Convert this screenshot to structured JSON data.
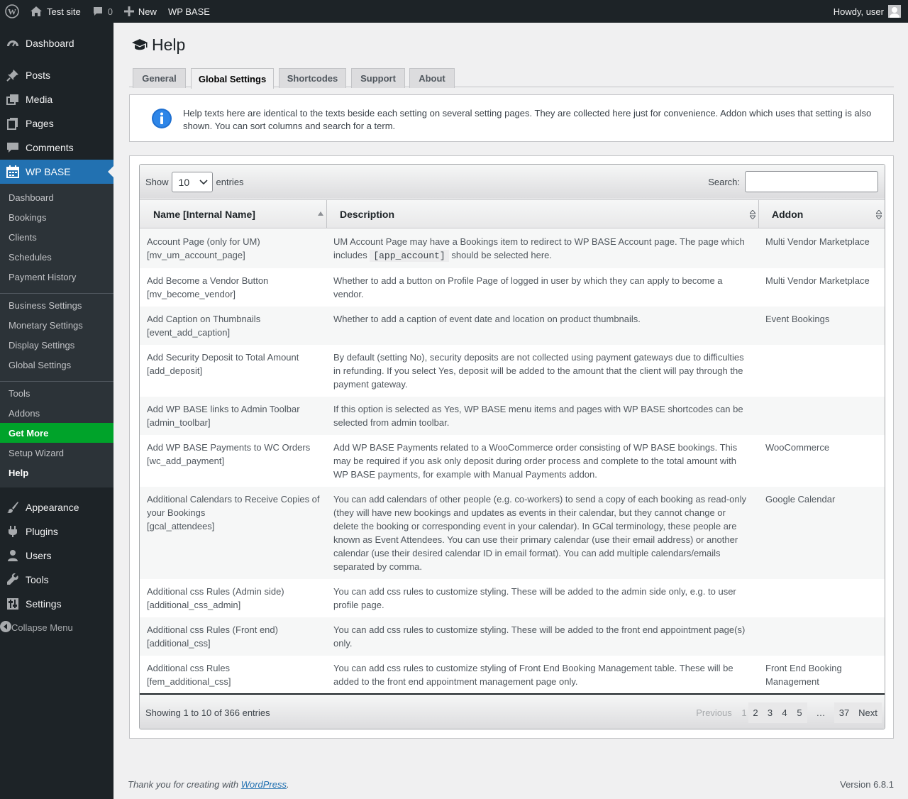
{
  "adminbar": {
    "site_name": "Test site",
    "comments_count": "0",
    "new_label": "New",
    "plugin_label": "WP BASE",
    "howdy": "Howdy, user"
  },
  "sidebar": {
    "top_items": [
      {
        "label": "Dashboard",
        "icon": "dashboard-icon"
      },
      {
        "label": "Posts",
        "icon": "pushpin-icon"
      },
      {
        "label": "Media",
        "icon": "media-icon"
      },
      {
        "label": "Pages",
        "icon": "pages-icon"
      },
      {
        "label": "Comments",
        "icon": "comments-icon"
      },
      {
        "label": "WP BASE",
        "icon": "calendar-icon"
      }
    ],
    "sub_items": [
      "Dashboard",
      "Bookings",
      "Clients",
      "Schedules",
      "Payment History",
      "Business Settings",
      "Monetary Settings",
      "Display Settings",
      "Global Settings",
      "Tools",
      "Addons",
      "Get More",
      "Setup Wizard",
      "Help"
    ],
    "bottom_items": [
      {
        "label": "Appearance",
        "icon": "brush-icon"
      },
      {
        "label": "Plugins",
        "icon": "plugin-icon"
      },
      {
        "label": "Users",
        "icon": "users-icon"
      },
      {
        "label": "Tools",
        "icon": "wrench-icon"
      },
      {
        "label": "Settings",
        "icon": "settings-icon"
      }
    ],
    "collapse": "Collapse Menu"
  },
  "page": {
    "title": "Help",
    "tabs": [
      "General",
      "Global Settings",
      "Shortcodes",
      "Support",
      "About"
    ],
    "notice": "Help texts here are identical to the texts beside each setting on several setting pages. They are collected here just for convenience. Addon which uses that setting is also shown. You can sort columns and search for a term."
  },
  "table": {
    "show_label": "Show",
    "entries_value": "10",
    "entries_label": "entries",
    "search_label": "Search:",
    "columns": [
      "Name [Internal Name]",
      "Description",
      "Addon"
    ],
    "rows": [
      {
        "name": "Account Page (only for UM)",
        "internal": "[mv_um_account_page]",
        "desc_before": "UM Account Page may have a Bookings item to redirect to WP BASE Account page. The page which includes ",
        "desc_code": "[app_account]",
        "desc_after": " should be selected here.",
        "addon": "Multi Vendor Marketplace"
      },
      {
        "name": "Add Become a Vendor Button",
        "internal": "[mv_become_vendor]",
        "desc": "Whether to add a button on Profile Page of logged in user by which they can apply to become a vendor.",
        "addon": "Multi Vendor Marketplace"
      },
      {
        "name": "Add Caption on Thumbnails",
        "internal": "[event_add_caption]",
        "desc": "Whether to add a caption of event date and location on product thumbnails.",
        "addon": "Event Bookings"
      },
      {
        "name": "Add Security Deposit to Total Amount",
        "internal": "[add_deposit]",
        "desc": "By default (setting No), security deposits are not collected using payment gateways due to difficulties in refunding. If you select Yes, deposit will be added to the amount that the client will pay through the payment gateway.",
        "addon": ""
      },
      {
        "name": "Add WP BASE links to Admin Toolbar",
        "internal": "[admin_toolbar]",
        "desc": "If this option is selected as Yes, WP BASE menu items and pages with WP BASE shortcodes can be selected from admin toolbar.",
        "addon": ""
      },
      {
        "name": "Add WP BASE Payments to WC Orders",
        "internal": "[wc_add_payment]",
        "desc": "Add WP BASE Payments related to a WooCommerce order consisting of WP BASE bookings. This may be required if you ask only deposit during order process and complete to the total amount with WP BASE payments, for example with Manual Payments addon.",
        "addon": "WooCommerce"
      },
      {
        "name": "Additional Calendars to Receive Copies of your Bookings",
        "internal": "[gcal_attendees]",
        "desc": "You can add calendars of other people (e.g. co-workers) to send a copy of each booking as read-only (they will have new bookings and updates as events in their calendar, but they cannot change or delete the booking or corresponding event in your calendar). In GCal terminology, these people are known as Event Attendees. You can use their primary calendar (use their email address) or another calendar (use their desired calendar ID in email format). You can add multiple calendars/emails separated by comma.",
        "addon": "Google Calendar"
      },
      {
        "name": "Additional css Rules (Admin side)",
        "internal": "[additional_css_admin]",
        "desc": "You can add css rules to customize styling. These will be added to the admin side only, e.g. to user profile page.",
        "addon": ""
      },
      {
        "name": "Additional css Rules (Front end)",
        "internal": "[additional_css]",
        "desc": "You can add css rules to customize styling. These will be added to the front end appointment page(s) only.",
        "addon": ""
      },
      {
        "name": "Additional css Rules",
        "internal": "[fem_additional_css]",
        "desc": "You can add css rules to customize styling of Front End Booking Management table. These will be added to the front end appointment management page only.",
        "addon": "Front End Booking Management"
      }
    ],
    "info": "Showing 1 to 10 of 366 entries",
    "pager": [
      "Previous",
      "1",
      "2",
      "3",
      "4",
      "5",
      "…",
      "37",
      "Next"
    ]
  },
  "footer": {
    "thanks_before": "Thank you for creating with ",
    "thanks_link": "WordPress",
    "thanks_after": ".",
    "version": "Version 6.8.1"
  },
  "colors": {
    "sidebar_bg": "#1d2327",
    "accent": "#2271b1",
    "get_more": "#00a32a"
  }
}
